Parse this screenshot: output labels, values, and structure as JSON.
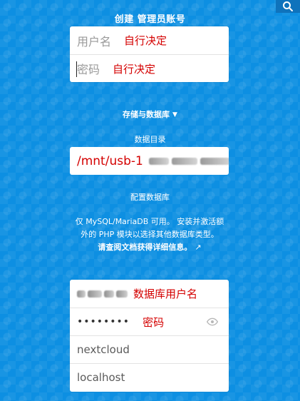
{
  "header": {
    "search_icon": "search-icon"
  },
  "admin": {
    "title": "创建 管理员账号",
    "username_placeholder": "用户名",
    "username_note": "自行决定",
    "password_placeholder": "密码",
    "password_note": "自行决定"
  },
  "storage": {
    "toggle_label": "存储与数据库",
    "data_dir_label": "数据目录",
    "data_dir_value": "/mnt/usb-1"
  },
  "database": {
    "section_title": "配置数据库",
    "info_line1": "仅 MySQL/MariaDB 可用。 安装并激活额",
    "info_line2": "外的 PHP 模块以选择其他数据库类型。",
    "info_link": "请查阅文档获得详细信息。",
    "username_note": "数据库用户名",
    "password_mask": "••••••••",
    "password_note": "密码",
    "db_name": "nextcloud",
    "db_host": "localhost"
  },
  "colors": {
    "background": "#0d8fe2",
    "annotation_red": "#d40000"
  }
}
